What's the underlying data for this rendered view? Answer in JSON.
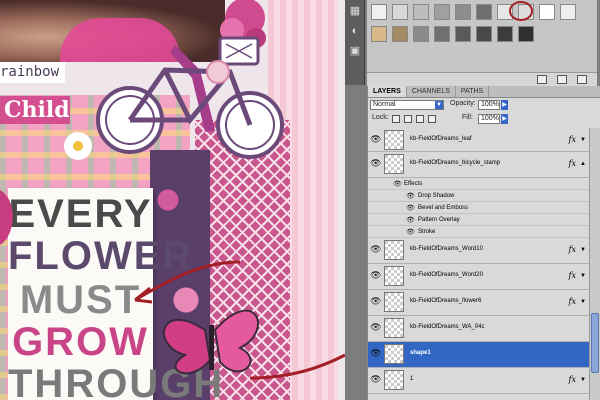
{
  "canvas": {
    "tags": {
      "rainbow": "rainbow",
      "child": "Child"
    },
    "quote": [
      "EVERY",
      "FLOWER",
      "MUST",
      "GROW",
      "THROUGH"
    ],
    "colors": {
      "accent_pink": "#c94587",
      "purple": "#5c4a6d",
      "bike": "#6b4a7a",
      "arrow": "#a41f25"
    }
  },
  "styles_panel": {
    "swatch_colors": [
      "#f0f0f0",
      "#d8d8d8",
      "#bdbdbd",
      "#a0a0a0",
      "#8d8d8d",
      "#6e6e6e",
      "#e6e6e6",
      "#dcdcdc",
      "#ffffff",
      "#eeeeee",
      "#d9b98a",
      "#a58a66",
      "#8a8a8a",
      "#707070",
      "#5a5a5a",
      "#484848",
      "#3c3c3c",
      "#303030"
    ]
  },
  "layers_panel": {
    "tabs": [
      "LAYERS",
      "CHANNELS",
      "PATHS"
    ],
    "active_tab": "LAYERS",
    "blend_mode": "Normal",
    "opacity_label": "Opacity:",
    "opacity_value": "100%",
    "lock_label": "Lock:",
    "fill_label": "Fill:",
    "fill_value": "100%",
    "layers": [
      {
        "name": "kb-FieldOfDreams_leaf",
        "fx": "fx"
      },
      {
        "name": "kb-FieldOfDreams_bicycle_stamp",
        "fx": "fx"
      },
      {
        "name": "kb-FieldOfDreams_Word10",
        "fx": "fx"
      },
      {
        "name": "kb-FieldOfDreams_Word20",
        "fx": "fx"
      },
      {
        "name": "kb-FieldOfDreams_flower6",
        "fx": "fx"
      },
      {
        "name": "kb-FieldOfDreams_WA_04c",
        "fx": ""
      },
      {
        "name": "shape1",
        "fx": "",
        "selected": true
      },
      {
        "name": "1",
        "fx": "fx"
      }
    ],
    "effects_label": "Effects",
    "effects": [
      "Drop Shadow",
      "Bevel and Emboss",
      "Pattern Overlay",
      "Stroke"
    ]
  }
}
